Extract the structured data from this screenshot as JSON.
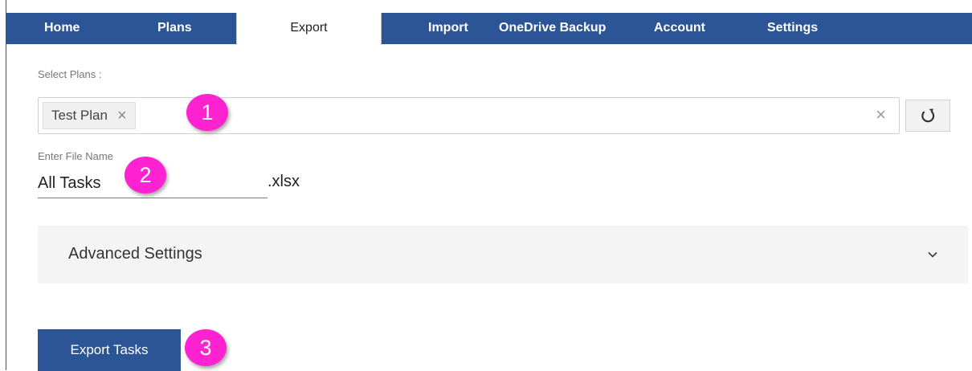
{
  "nav": {
    "tabs": [
      {
        "label": "Home",
        "active": false
      },
      {
        "label": "Plans",
        "active": false
      },
      {
        "label": "Export",
        "active": true
      },
      {
        "label": "Import",
        "active": false
      },
      {
        "label": "OneDrive Backup",
        "active": false
      },
      {
        "label": "Account",
        "active": false
      },
      {
        "label": "Settings",
        "active": false
      }
    ]
  },
  "plans": {
    "label": "Select Plans :",
    "selected": [
      {
        "label": "Test Plan"
      }
    ],
    "remove_icon": "close-icon",
    "clear_icon": "close-icon",
    "refresh_icon": "refresh-icon"
  },
  "file": {
    "label": "Enter File Name",
    "value": "All Tasks",
    "extension": ".xlsx"
  },
  "advanced": {
    "label": "Advanced Settings",
    "icon": "chevron-down-icon"
  },
  "actions": {
    "export_label": "Export Tasks"
  },
  "markers": [
    "1",
    "2",
    "3"
  ],
  "colors": {
    "nav_bg": "#2c5597",
    "button_bg": "#2c5597",
    "marker": "#ff22d0",
    "panel_bg": "#f4f4f4"
  }
}
